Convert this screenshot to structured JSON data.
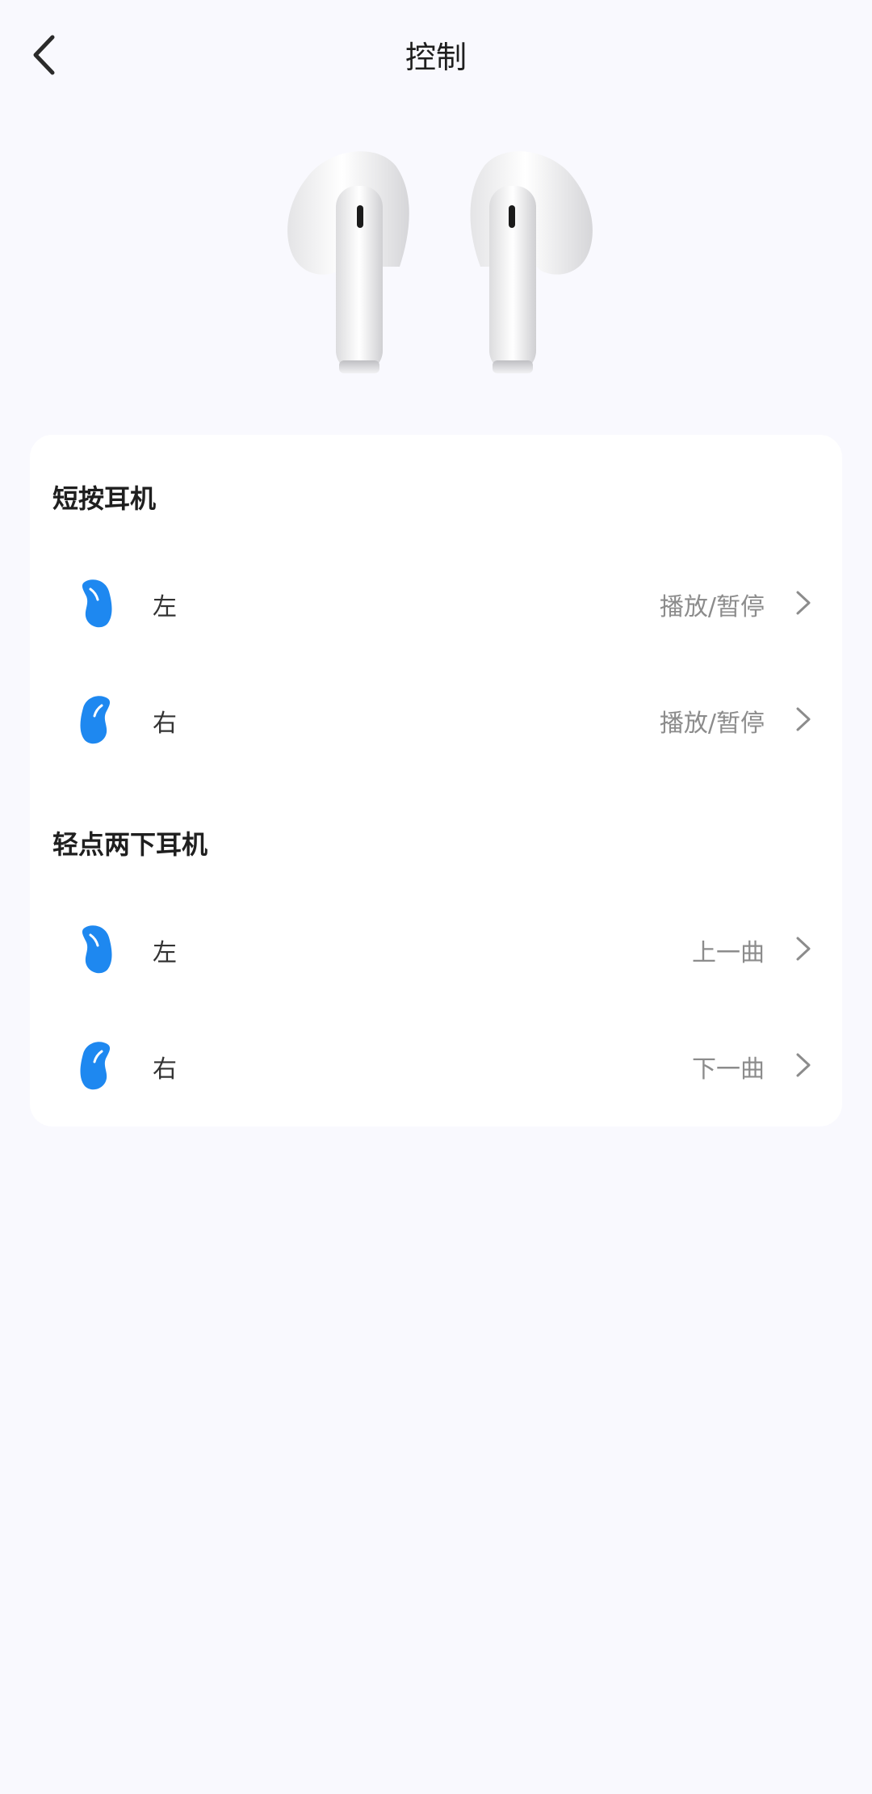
{
  "header": {
    "title": "控制",
    "back_icon": "chevron-left-icon"
  },
  "hero": {
    "image": "earbuds-product-image"
  },
  "sections": [
    {
      "title": "短按耳机",
      "rows": [
        {
          "side": "左",
          "value": "播放/暂停",
          "icon": "left-earbud-icon"
        },
        {
          "side": "右",
          "value": "播放/暂停",
          "icon": "right-earbud-icon"
        }
      ]
    },
    {
      "title": "轻点两下耳机",
      "rows": [
        {
          "side": "左",
          "value": "上一曲",
          "icon": "left-earbud-icon"
        },
        {
          "side": "右",
          "value": "下一曲",
          "icon": "right-earbud-icon"
        }
      ]
    }
  ],
  "colors": {
    "background": "#f9f9fe",
    "card": "#ffffff",
    "accent": "#1e88f0",
    "secondary_text": "#8c8c8c"
  }
}
